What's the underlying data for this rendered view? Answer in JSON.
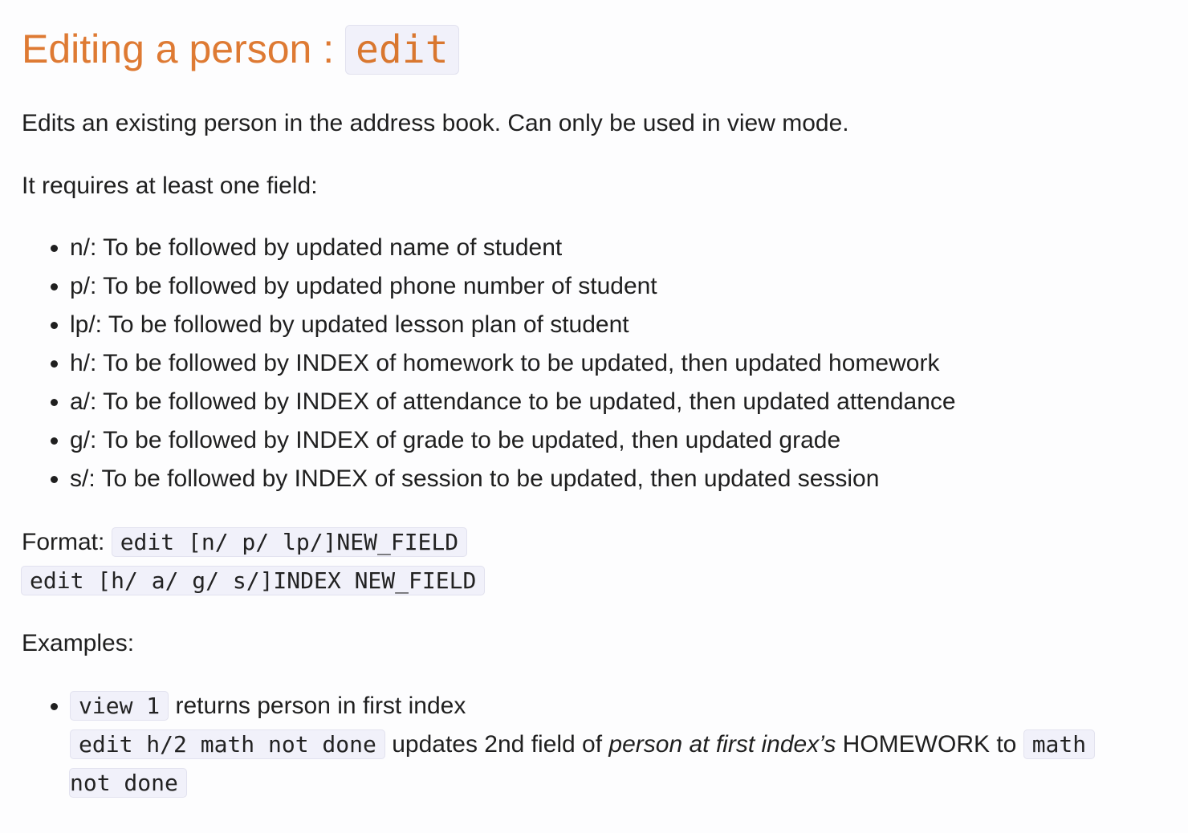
{
  "heading": {
    "text": "Editing a person : ",
    "code": "edit"
  },
  "description": "Edits an existing person in the address book. Can only be used in view mode.",
  "requirement": "It requires at least one field:",
  "fields": [
    "n/: To be followed by updated name of student",
    "p/: To be followed by updated phone number of student",
    "lp/: To be followed by updated lesson plan of student",
    "h/: To be followed by INDEX of homework to be updated, then updated homework",
    "a/: To be followed by INDEX of attendance to be updated, then updated attendance",
    "g/: To be followed by INDEX of grade to be updated, then updated grade",
    "s/: To be followed by INDEX of session to be updated, then updated session"
  ],
  "format": {
    "label": "Format: ",
    "code_1": "edit [n/ p/ lp/]NEW_FIELD",
    "code_2": "edit [h/ a/ g/ s/]INDEX NEW_FIELD"
  },
  "examples_label": "Examples:",
  "examples": {
    "view_code": "view 1",
    "view_text": " returns person in first index",
    "edit_code": "edit h/2 math not done",
    "edit_text_1": " updates 2nd field of ",
    "edit_text_italic": "person at first index’s",
    "edit_text_2": " HOMEWORK to ",
    "edit_code_2a": "math",
    "edit_code_2b": "not done"
  }
}
